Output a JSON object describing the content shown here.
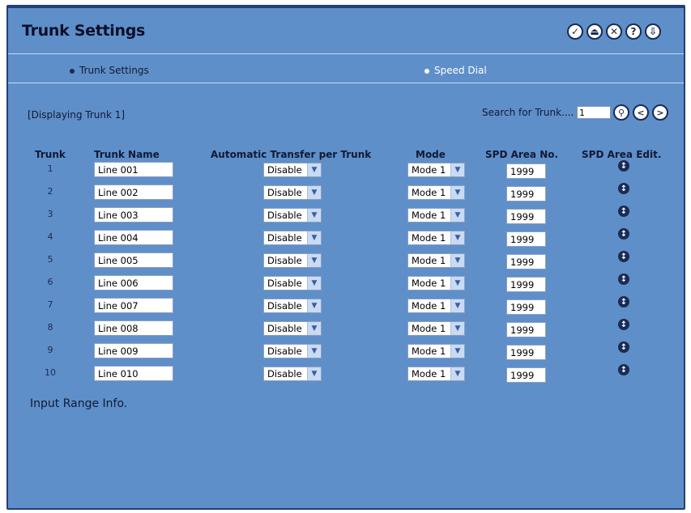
{
  "window": {
    "title": "Trunk Settings"
  },
  "toolbar": {
    "buttons": [
      {
        "name": "apply-icon",
        "glyph": "✓"
      },
      {
        "name": "save-icon",
        "glyph": "⏏"
      },
      {
        "name": "close-icon",
        "glyph": "✕"
      },
      {
        "name": "help-icon",
        "glyph": "?"
      },
      {
        "name": "exit-icon",
        "glyph": "⇩"
      }
    ]
  },
  "tabs": {
    "active": "Trunk Settings",
    "inactive": "Speed Dial"
  },
  "status": {
    "displaying": "[Displaying Trunk 1]"
  },
  "search": {
    "label": "Search for Trunk....",
    "value": "1"
  },
  "table": {
    "headers": {
      "trunk": "Trunk",
      "name": "Trunk Name",
      "transfer": "Automatic Transfer per Trunk",
      "mode": "Mode",
      "spd_area": "SPD Area No.",
      "spd_edit": "SPD Area Edit."
    },
    "rows": [
      {
        "trunk": "1",
        "name": "Line 001",
        "transfer": "Disable",
        "mode": "Mode 1",
        "spd": "1999"
      },
      {
        "trunk": "2",
        "name": "Line 002",
        "transfer": "Disable",
        "mode": "Mode 1",
        "spd": "1999"
      },
      {
        "trunk": "3",
        "name": "Line 003",
        "transfer": "Disable",
        "mode": "Mode 1",
        "spd": "1999"
      },
      {
        "trunk": "4",
        "name": "Line 004",
        "transfer": "Disable",
        "mode": "Mode 1",
        "spd": "1999"
      },
      {
        "trunk": "5",
        "name": "Line 005",
        "transfer": "Disable",
        "mode": "Mode 1",
        "spd": "1999"
      },
      {
        "trunk": "6",
        "name": "Line 006",
        "transfer": "Disable",
        "mode": "Mode 1",
        "spd": "1999"
      },
      {
        "trunk": "7",
        "name": "Line 007",
        "transfer": "Disable",
        "mode": "Mode 1",
        "spd": "1999"
      },
      {
        "trunk": "8",
        "name": "Line 008",
        "transfer": "Disable",
        "mode": "Mode 1",
        "spd": "1999"
      },
      {
        "trunk": "9",
        "name": "Line 009",
        "transfer": "Disable",
        "mode": "Mode 1",
        "spd": "1999"
      },
      {
        "trunk": "10",
        "name": "Line 010",
        "transfer": "Disable",
        "mode": "Mode 1",
        "spd": "1999"
      }
    ]
  },
  "footer": {
    "info": "Input Range Info."
  },
  "colors": {
    "panel": "#5f8fc9",
    "border": "#233f78",
    "text": "#0f1a35"
  }
}
